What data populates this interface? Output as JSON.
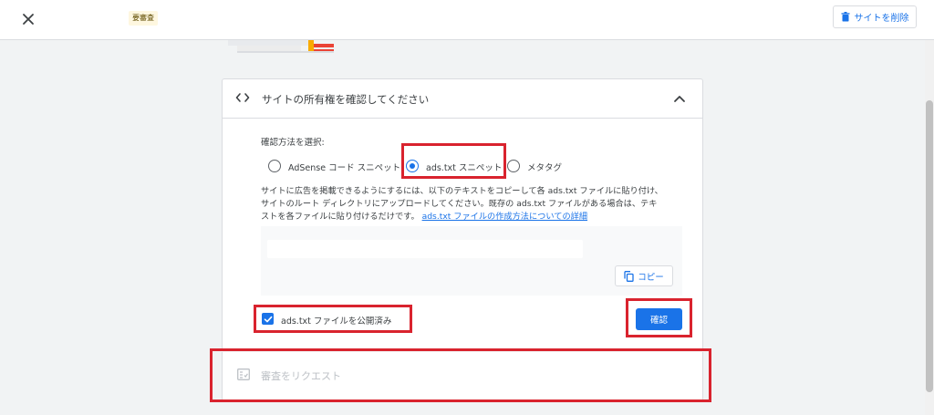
{
  "topbar": {
    "status_badge": "要審査",
    "delete_button": "サイトを削除"
  },
  "card": {
    "title": "サイトの所有権を確認してください",
    "method_label": "確認方法を選択:",
    "options": [
      {
        "label": "AdSense コード スニペット",
        "selected": false
      },
      {
        "label": "ads.txt スニペット",
        "selected": true
      },
      {
        "label": "メタタグ",
        "selected": false
      }
    ],
    "description_line1": "サイトに広告を掲載できるようにするには、以下のテキストをコピーして各 ads.txt ファイルに貼り付け、",
    "description_line2": "サイトのルート ディレクトリにアップロードしてください。既存の ads.txt ファイルがある場合は、テキ",
    "description_line3": "ストを各ファイルに貼り付けるだけです。",
    "description_link": "ads.txt ファイルの作成方法についての詳細",
    "copy_button": "コピー",
    "published_checkbox_label": "ads.txt ファイルを公開済み",
    "published_checked": true,
    "confirm_button": "確認"
  },
  "review": {
    "label": "審査をリクエスト"
  },
  "colors": {
    "accent": "#1a73e8",
    "highlight": "#d9232e"
  }
}
